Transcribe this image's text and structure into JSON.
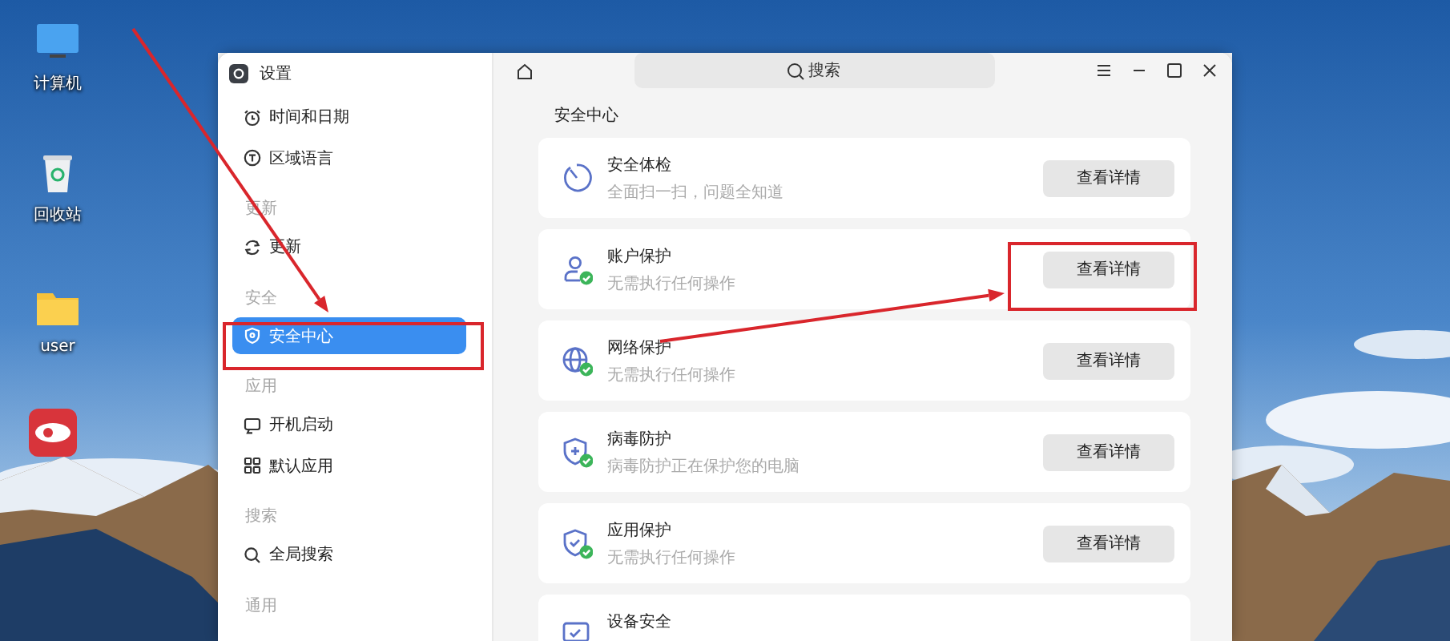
{
  "desktop": {
    "icons": [
      {
        "kind": "computer",
        "label": "计算机"
      },
      {
        "kind": "trash",
        "label": "回收站"
      },
      {
        "kind": "folder",
        "label": "user"
      },
      {
        "kind": "app"
      }
    ]
  },
  "window": {
    "title": "设置",
    "search": {
      "placeholder": "搜索"
    }
  },
  "sidebar": {
    "groups": [
      {
        "items": [
          {
            "kind": "clock",
            "label": "时间和日期",
            "selected": false
          },
          {
            "kind": "language",
            "label": "区域语言",
            "selected": false
          }
        ]
      },
      {
        "header": "更新",
        "items": [
          {
            "kind": "refresh",
            "label": "更新",
            "selected": false
          }
        ]
      },
      {
        "header": "安全",
        "items": [
          {
            "kind": "shield",
            "label": "安全中心",
            "selected": true
          }
        ]
      },
      {
        "header": "应用",
        "items": [
          {
            "kind": "startup",
            "label": "开机启动",
            "selected": false
          },
          {
            "kind": "grid",
            "label": "默认应用",
            "selected": false
          }
        ]
      },
      {
        "header": "搜索",
        "items": [
          {
            "kind": "search",
            "label": "全局搜索",
            "selected": false
          }
        ]
      },
      {
        "header": "通用"
      }
    ]
  },
  "content": {
    "heading": "安全中心",
    "cards": [
      {
        "kind": "scan",
        "title": "安全体检",
        "subtitle": "全面扫一扫，问题全知道",
        "button": "查看详情"
      },
      {
        "kind": "account",
        "title": "账户保护",
        "subtitle": "无需执行任何操作",
        "button": "查看详情"
      },
      {
        "kind": "network",
        "title": "网络保护",
        "subtitle": "无需执行任何操作",
        "button": "查看详情"
      },
      {
        "kind": "virus",
        "title": "病毒防护",
        "subtitle": "病毒防护正在保护您的电脑",
        "button": "查看详情"
      },
      {
        "kind": "app",
        "title": "应用保护",
        "subtitle": "无需执行任何操作",
        "button": "查看详情"
      },
      {
        "kind": "device",
        "title": "设备安全"
      }
    ]
  }
}
